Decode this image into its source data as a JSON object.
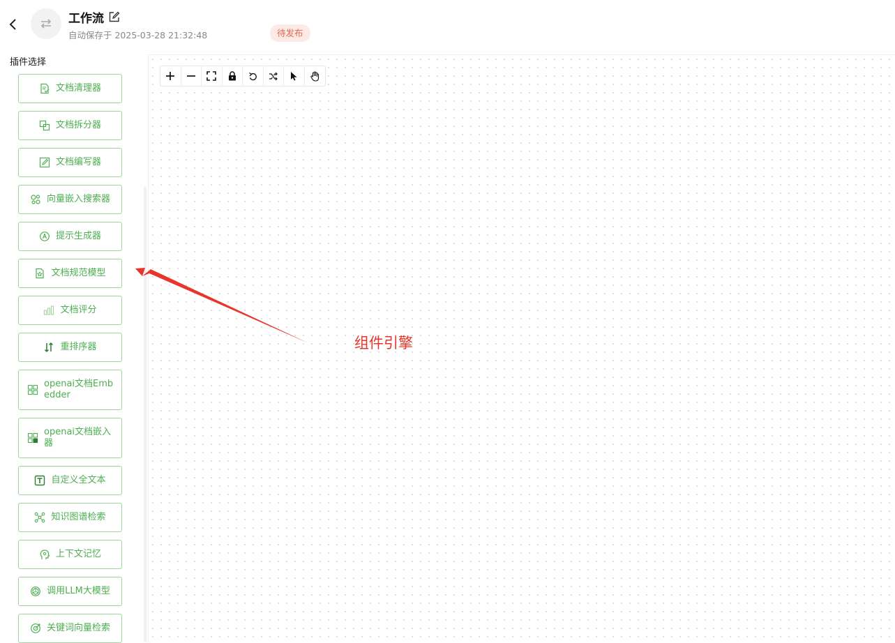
{
  "header": {
    "title": "工作流",
    "saved_text": "自动保存于 2025-03-28 21:32:48",
    "status": "待发布"
  },
  "sidebar": {
    "title": "插件选择",
    "items": [
      {
        "label": "文档清理器",
        "icon": "document-clean-icon"
      },
      {
        "label": "文档拆分器",
        "icon": "document-split-icon"
      },
      {
        "label": "文档编写器",
        "icon": "document-edit-icon"
      },
      {
        "label": "向量嵌入搜索器",
        "icon": "vector-search-icon"
      },
      {
        "label": "提示生成器",
        "icon": "prompt-icon"
      },
      {
        "label": "文档规范模型",
        "icon": "document-star-icon"
      },
      {
        "label": "文档评分",
        "icon": "bar-chart-icon"
      },
      {
        "label": "重排序器",
        "icon": "sort-arrows-icon"
      },
      {
        "label": "openai文档Embedder",
        "icon": "grid-icon"
      },
      {
        "label": "openai文档嵌入器",
        "icon": "grid-check-icon"
      },
      {
        "label": "自定义全文本",
        "icon": "text-box-icon"
      },
      {
        "label": "知识图谱检索",
        "icon": "graph-nodes-icon"
      },
      {
        "label": "上下文记忆",
        "icon": "memory-head-icon"
      },
      {
        "label": "调用LLM大模型",
        "icon": "llm-icon"
      },
      {
        "label": "关键词向量检索",
        "icon": "target-search-icon"
      }
    ]
  },
  "toolbar": {
    "tools": [
      "zoom-in-icon",
      "zoom-out-icon",
      "fit-view-icon",
      "lock-icon",
      "undo-icon",
      "shuffle-icon",
      "pointer-icon",
      "hand-icon"
    ]
  },
  "annotation": {
    "text": "组件引擎",
    "color": "#e8352b"
  },
  "colors": {
    "accent": "#4caf50",
    "button_border": "#9fd69a",
    "status_bg": "#fdeae6",
    "status_text": "#e06b4d"
  }
}
